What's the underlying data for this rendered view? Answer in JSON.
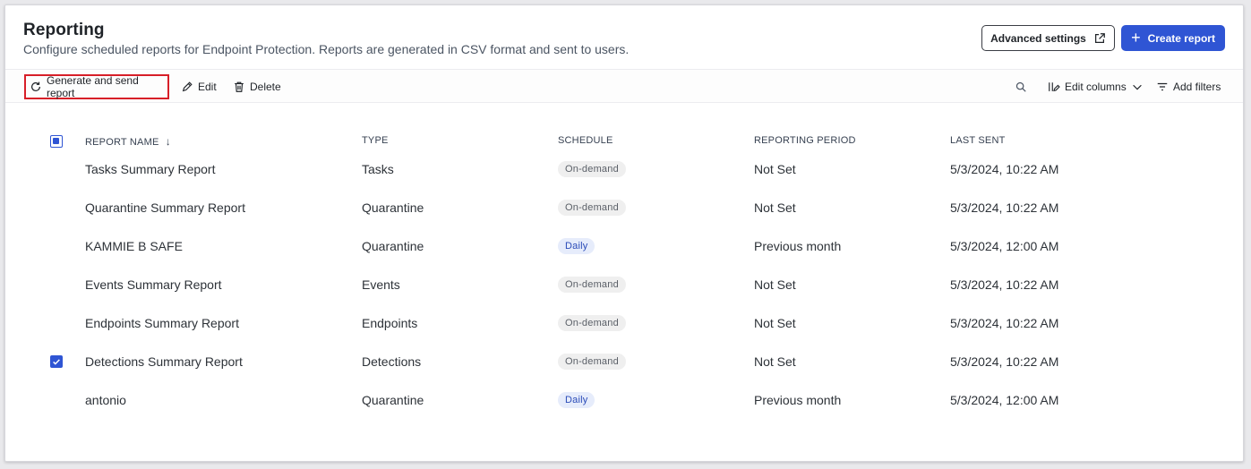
{
  "header": {
    "title": "Reporting",
    "subtitle": "Configure scheduled reports for Endpoint Protection. Reports are generated in CSV format and sent to users.",
    "advanced_settings_label": "Advanced settings",
    "create_report_label": "Create report"
  },
  "toolbar": {
    "generate_label": "Generate and send report",
    "edit_label": "Edit",
    "delete_label": "Delete",
    "edit_columns_label": "Edit columns",
    "add_filters_label": "Add filters"
  },
  "table": {
    "columns": [
      "REPORT NAME",
      "TYPE",
      "SCHEDULE",
      "REPORTING PERIOD",
      "LAST SENT"
    ],
    "sort_indicator": "↓",
    "rows": [
      {
        "name": "Tasks Summary Report",
        "type": "Tasks",
        "schedule": "On-demand",
        "period": "Not Set",
        "last_sent": "5/3/2024, 10:22 AM",
        "checked": false
      },
      {
        "name": "Quarantine Summary Report",
        "type": "Quarantine",
        "schedule": "On-demand",
        "period": "Not Set",
        "last_sent": "5/3/2024, 10:22 AM",
        "checked": false
      },
      {
        "name": "KAMMIE B SAFE",
        "type": "Quarantine",
        "schedule": "Daily",
        "period": "Previous month",
        "last_sent": "5/3/2024, 12:00 AM",
        "checked": false
      },
      {
        "name": "Events Summary Report",
        "type": "Events",
        "schedule": "On-demand",
        "period": "Not Set",
        "last_sent": "5/3/2024, 10:22 AM",
        "checked": false
      },
      {
        "name": "Endpoints Summary Report",
        "type": "Endpoints",
        "schedule": "On-demand",
        "period": "Not Set",
        "last_sent": "5/3/2024, 10:22 AM",
        "checked": false
      },
      {
        "name": "Detections Summary Report",
        "type": "Detections",
        "schedule": "On-demand",
        "period": "Not Set",
        "last_sent": "5/3/2024, 10:22 AM",
        "checked": true
      },
      {
        "name": "antonio",
        "type": "Quarantine",
        "schedule": "Daily",
        "period": "Previous month",
        "last_sent": "5/3/2024, 12:00 AM",
        "checked": false
      }
    ]
  },
  "colors": {
    "primary": "#2f55d4",
    "highlight_border": "#d71f28",
    "badge_ondemand_bg": "#efefef",
    "badge_daily_bg": "#e6ecfb"
  }
}
